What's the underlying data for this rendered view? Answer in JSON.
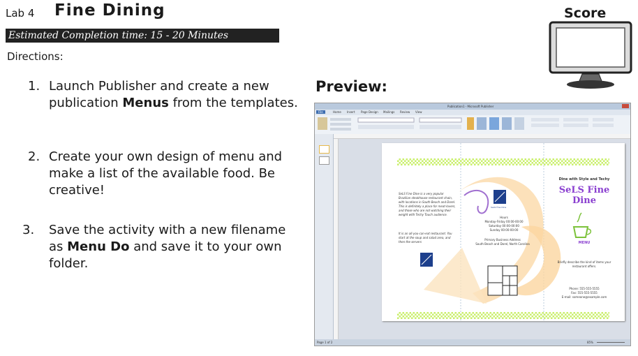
{
  "header": {
    "lab_label": "Lab 4",
    "lab_title": "Fine Dining",
    "estimated_time": "Estimated Completion time: 15 - 20 Minutes",
    "directions": "Directions:"
  },
  "steps": [
    {
      "num": "1.",
      "pre": "Launch Publisher and create a new publication ",
      "bold": "Menus",
      "post": " from the templates."
    },
    {
      "num": "2.",
      "text": "Create your own design of menu and make a list of the available food. Be creative!"
    },
    {
      "num": "3.",
      "pre": "Save the activity with a new filename as ",
      "bold": "Menu Do",
      "post": " and save it to your own folder."
    }
  ],
  "score": {
    "label": "Score"
  },
  "preview": {
    "label": "Preview:",
    "window_title": "Publication1 - Microsoft Publisher",
    "tabs": [
      "File",
      "Home",
      "Insert",
      "Page Design",
      "Mailings",
      "Review",
      "View"
    ],
    "status_left": "Page 1 of 2",
    "zoom": "85%",
    "brochure": {
      "tagline": "Dine with Style and Techy",
      "name": "SeLS Fine Dine",
      "menu": "MENU",
      "hours_title": "Hours",
      "hours_1": "Monday-Friday 00:00-00:00",
      "hours_2": "Saturday 00:00-00:00",
      "hours_3": "Sunday 00:00-00:00",
      "address_title": "Primary Business Address",
      "address_line": "South Beach and Dorel, North Carolina",
      "describe": "Briefly describe the kind of items your restaurant offers.",
      "phone": "Phone: 555-555-5555",
      "fax": "Fax: 555-555-5555",
      "email": "E-mail: someone@example.com",
      "logo_text": "SeLS Fine Dine"
    }
  }
}
